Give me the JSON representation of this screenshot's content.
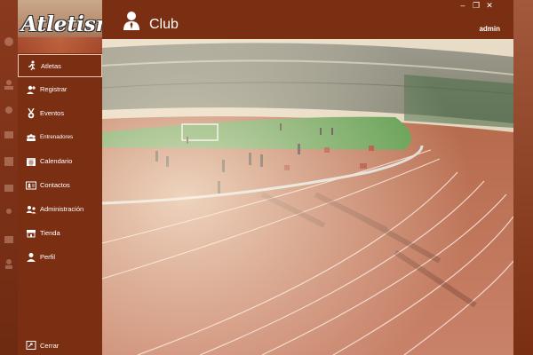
{
  "app": {
    "logo_text": "Atletismo"
  },
  "header": {
    "title": "Club",
    "username": "admin"
  },
  "window_controls": {
    "minimize": "–",
    "restore": "❐",
    "close": "✕"
  },
  "sidebar": {
    "items": [
      {
        "label": "Atletas",
        "icon": "runner-icon",
        "active": true
      },
      {
        "label": "Registrar",
        "icon": "add-user-icon"
      },
      {
        "label": "Eventos",
        "icon": "medal-icon"
      },
      {
        "label": "Entrenadores",
        "icon": "group-icon"
      },
      {
        "label": "Calendario",
        "icon": "calendar-icon"
      },
      {
        "label": "Contactos",
        "icon": "contact-card-icon"
      },
      {
        "label": "Administración",
        "icon": "admin-users-icon"
      },
      {
        "label": "Tienda",
        "icon": "store-icon"
      },
      {
        "label": "Perfil",
        "icon": "profile-icon"
      }
    ],
    "logout_label": "Cerrar"
  },
  "colors": {
    "sidebar_bg": "#7a2e12",
    "text": "#ffffff",
    "active_border": "#f2c9b5",
    "track": "#b5583a"
  }
}
